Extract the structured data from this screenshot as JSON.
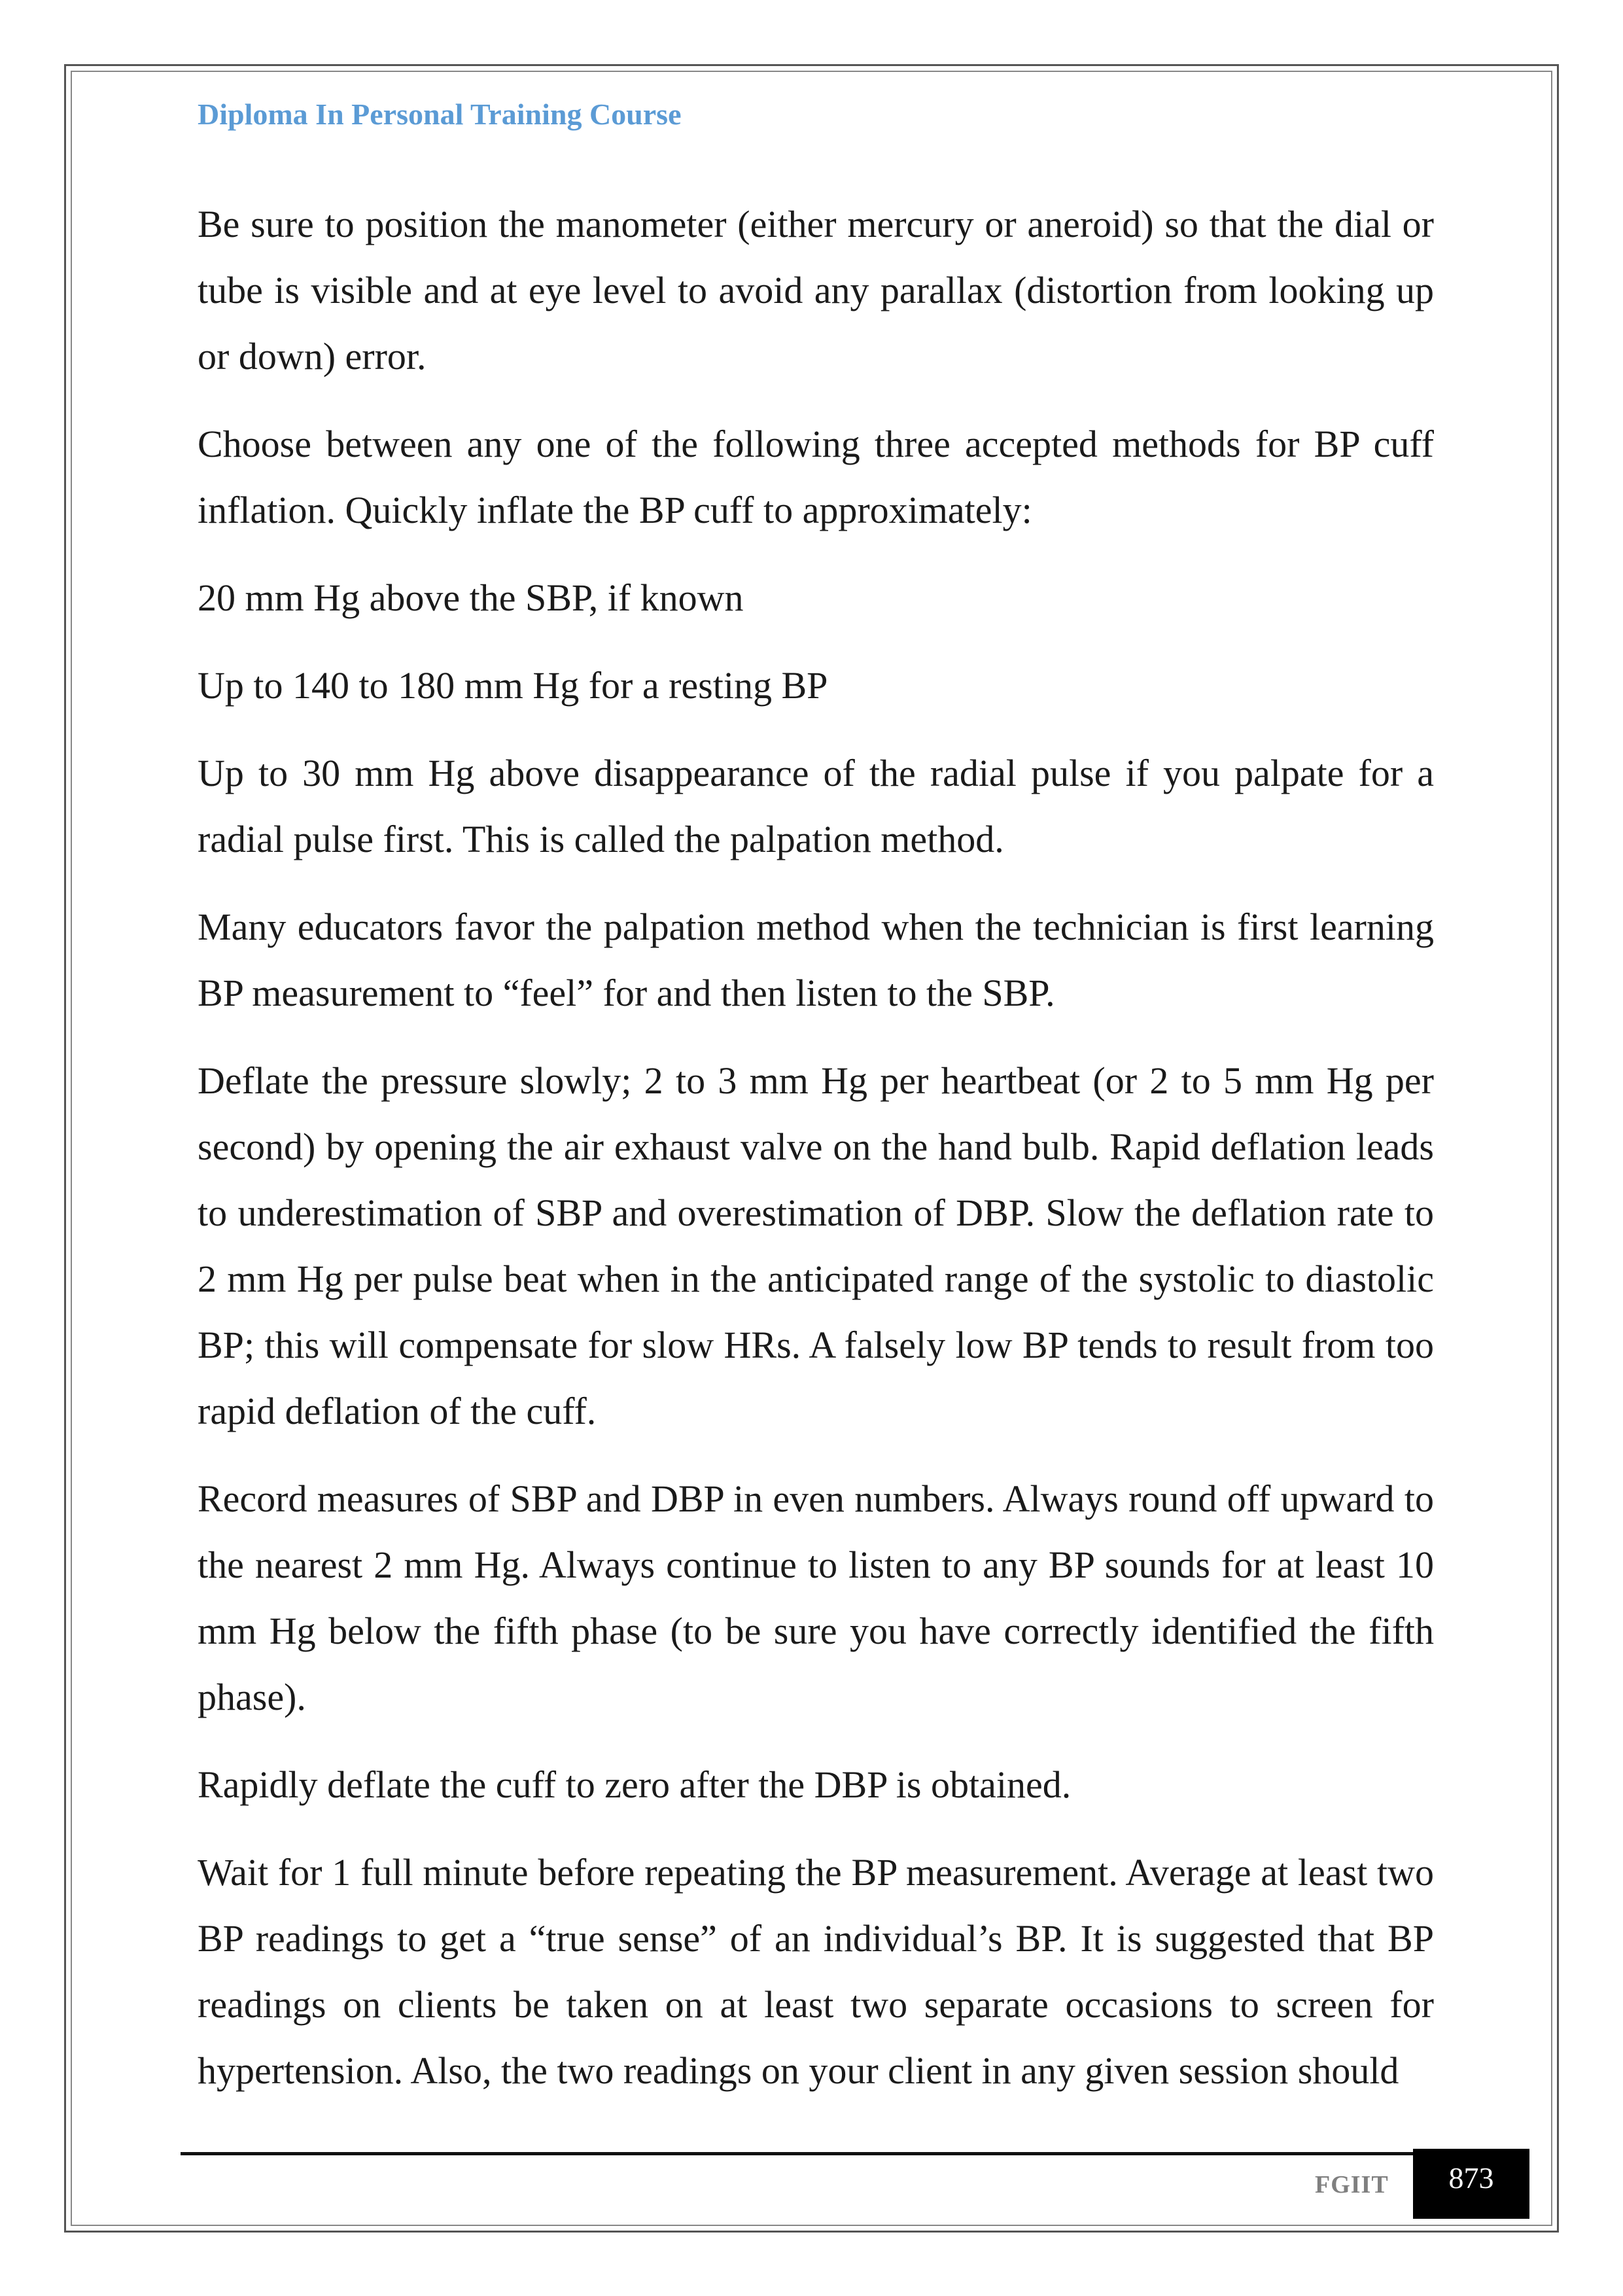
{
  "header": {
    "title": "Diploma In Personal Training Course"
  },
  "paragraphs": [
    "Be sure to position the manometer (either mercury or aneroid) so that the dial or tube is visible and at eye level to avoid any parallax (distortion from looking up or down) error.",
    "Choose between any one of the following three accepted methods for BP cuff inflation. Quickly inflate the BP cuff to approximately:",
    "20 mm Hg above the SBP, if known",
    "Up to 140 to 180 mm Hg for a resting BP",
    "Up to 30 mm Hg above disappearance of the radial pulse if you palpate for a radial pulse first. This is called the palpation method.",
    "Many educators favor the palpation method when the technician is first learning BP measurement to “feel” for and then listen to the SBP.",
    "Deflate the pressure slowly; 2 to 3 mm Hg per heartbeat (or 2 to 5 mm Hg per second) by opening the air exhaust valve on the hand bulb. Rapid deflation leads to underestimation of SBP and overestimation of DBP. Slow the deflation rate to 2 mm Hg per pulse beat when in the anticipated range of the systolic to diastolic BP; this will compensate for slow HRs. A falsely low BP tends to result from too rapid deflation of the cuff.",
    "Record measures of SBP and DBP in even numbers. Always round off upward to the nearest 2 mm Hg. Always continue to listen to any BP sounds for at least 10 mm Hg below the fifth phase (to be sure you have correctly identified the fifth phase).",
    "Rapidly deflate the cuff to zero after the DBP is obtained.",
    "Wait for 1 full minute before repeating the BP measurement. Average at least two BP readings to get a “true sense” of an individual’s BP. It is suggested that BP readings on clients be taken on at least two separate occasions to screen for hypertension. Also, the two readings on your client in any given session should"
  ],
  "footer": {
    "organization": "FGIIT",
    "page_number": "873"
  },
  "colors": {
    "header_text": "#5b9bd5",
    "body_text": "#1a1a1a",
    "footer_org_text": "#7f7f7f",
    "page_number_bg": "#000000",
    "page_number_text": "#ffffff"
  }
}
